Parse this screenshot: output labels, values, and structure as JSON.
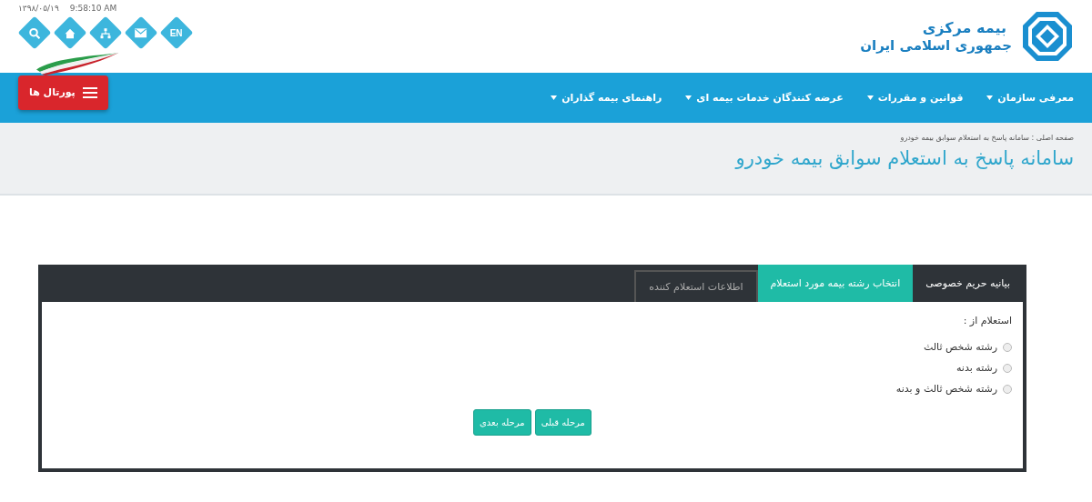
{
  "header": {
    "logo_lines": [
      "بیمه مرکزی",
      "جمهوری اسلامی ایران"
    ],
    "date": "۱۳۹۸/۰۵/۱۹",
    "time": "9:58:10 AM",
    "quick_links": [
      {
        "kind": "search"
      },
      {
        "kind": "home"
      },
      {
        "kind": "sitemap"
      },
      {
        "kind": "mail"
      },
      {
        "kind": "lang",
        "label": "EN"
      }
    ]
  },
  "nav": {
    "items": [
      {
        "label": "معرفی سازمان"
      },
      {
        "label": "قوانین و مقررات"
      },
      {
        "label": "عرضه کنندگان خدمات بیمه ای"
      },
      {
        "label": "راهنمای بیمه گذاران"
      }
    ],
    "portal_button": "پورتال ها"
  },
  "page_header": {
    "breadcrumb": "صفحه اصلی : سامانه پاسخ به استعلام سوابق بیمه خودرو",
    "title": "سامانه پاسخ به استعلام سوابق بیمه خودرو"
  },
  "wizard": {
    "tabs": [
      {
        "label": "بیانیه حریم خصوصی",
        "selected": false,
        "disabled": false
      },
      {
        "label": "انتخاب رشته بیمه مورد استعلام",
        "selected": true,
        "disabled": false
      },
      {
        "label": "اطلاعات استعلام کننده",
        "selected": false,
        "disabled": true
      }
    ],
    "question": "استعلام از :",
    "options": [
      {
        "label": "رشته شخص ثالث",
        "selected": false
      },
      {
        "label": "رشته بدنه",
        "selected": false
      },
      {
        "label": "رشته شخص ثالث و بدنه",
        "selected": false
      }
    ],
    "buttons": [
      "مرحله قبلی",
      "مرحله بعدی"
    ]
  }
}
